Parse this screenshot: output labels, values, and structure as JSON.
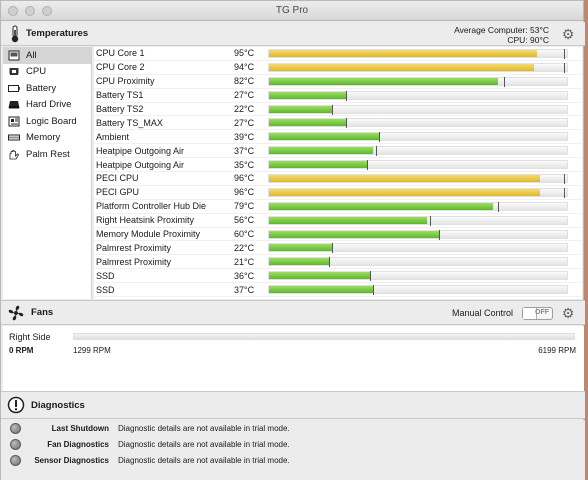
{
  "window": {
    "title": "TG Pro"
  },
  "temperatures": {
    "header": "Temperatures",
    "average_label": "Average Computer:",
    "average_value": "53°C",
    "cpu_label": "CPU:",
    "cpu_value": "90°C"
  },
  "sidebar": {
    "items": [
      {
        "label": "All",
        "icon": "all-icon"
      },
      {
        "label": "CPU",
        "icon": "cpu-icon"
      },
      {
        "label": "Battery",
        "icon": "battery-icon"
      },
      {
        "label": "Hard Drive",
        "icon": "hard-drive-icon"
      },
      {
        "label": "Logic Board",
        "icon": "logic-board-icon"
      },
      {
        "label": "Memory",
        "icon": "memory-icon"
      },
      {
        "label": "Palm Rest",
        "icon": "palm-rest-icon"
      }
    ],
    "selected": "All"
  },
  "sensors": [
    {
      "name": "CPU Core 1",
      "value": "95°C",
      "level": 0.9,
      "max": 0.99,
      "color": "yellow"
    },
    {
      "name": "CPU Core 2",
      "value": "94°C",
      "level": 0.89,
      "max": 0.99,
      "color": "yellow"
    },
    {
      "name": "CPU Proximity",
      "value": "82°C",
      "level": 0.77,
      "max": 0.79,
      "color": "green"
    },
    {
      "name": "Battery TS1",
      "value": "27°C",
      "level": 0.26,
      "max": 0.26,
      "color": "green"
    },
    {
      "name": "Battery TS2",
      "value": "22°C",
      "level": 0.21,
      "max": 0.21,
      "color": "green"
    },
    {
      "name": "Battery TS_MAX",
      "value": "27°C",
      "level": 0.26,
      "max": 0.26,
      "color": "green"
    },
    {
      "name": "Ambient",
      "value": "39°C",
      "level": 0.37,
      "max": 0.37,
      "color": "green"
    },
    {
      "name": "Heatpipe Outgoing Air",
      "value": "37°C",
      "level": 0.35,
      "max": 0.36,
      "color": "green"
    },
    {
      "name": "Heatpipe Outgoing Air",
      "value": "35°C",
      "level": 0.33,
      "max": 0.33,
      "color": "green"
    },
    {
      "name": "PECI CPU",
      "value": "96°C",
      "level": 0.91,
      "max": 0.99,
      "color": "yellow"
    },
    {
      "name": "PECI GPU",
      "value": "96°C",
      "level": 0.91,
      "max": 0.99,
      "color": "yellow"
    },
    {
      "name": "Platform Controller Hub Die",
      "value": "79°C",
      "level": 0.75,
      "max": 0.77,
      "color": "green"
    },
    {
      "name": "Right Heatsink Proximity",
      "value": "56°C",
      "level": 0.53,
      "max": 0.54,
      "color": "green"
    },
    {
      "name": "Memory Module Proximity",
      "value": "60°C",
      "level": 0.57,
      "max": 0.57,
      "color": "green"
    },
    {
      "name": "Palmrest Proximity",
      "value": "22°C",
      "level": 0.21,
      "max": 0.21,
      "color": "green"
    },
    {
      "name": "Palmrest Proximity",
      "value": "21°C",
      "level": 0.2,
      "max": 0.2,
      "color": "green"
    },
    {
      "name": "SSD",
      "value": "36°C",
      "level": 0.34,
      "max": 0.34,
      "color": "green"
    },
    {
      "name": "SSD",
      "value": "37°C",
      "level": 0.35,
      "max": 0.35,
      "color": "green"
    }
  ],
  "fans": {
    "header": "Fans",
    "manual_label": "Manual Control",
    "toggle_label": "OFF",
    "items": [
      {
        "name": "Right Side",
        "rpm": "0 RPM",
        "min": "1299 RPM",
        "max": "6199 RPM",
        "level": 0
      }
    ]
  },
  "diagnostics": {
    "header": "Diagnostics",
    "items": [
      {
        "label": "Last Shutdown",
        "text": "Diagnostic details are not available in trial mode."
      },
      {
        "label": "Fan Diagnostics",
        "text": "Diagnostic details are not available in trial mode."
      },
      {
        "label": "Sensor Diagnostics",
        "text": "Diagnostic details are not available in trial mode."
      }
    ]
  }
}
